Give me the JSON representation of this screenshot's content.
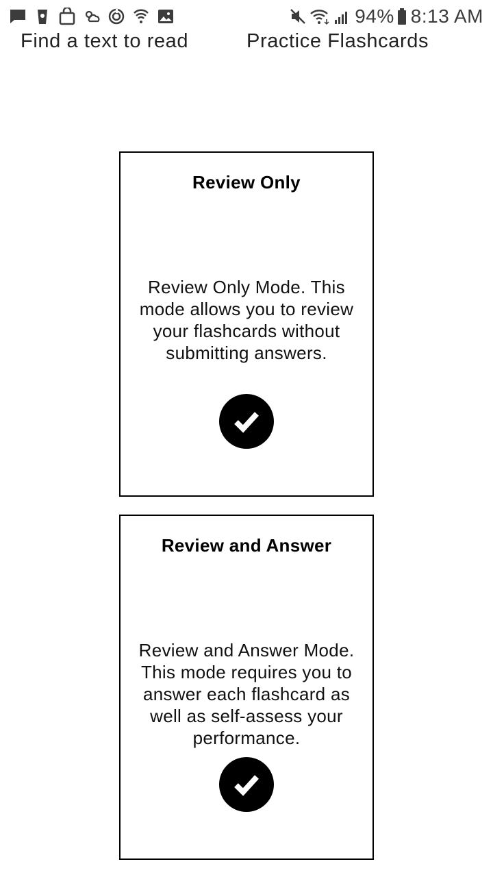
{
  "status_bar": {
    "notification_icons": [
      "message-icon",
      "cup-icon",
      "shopping-bag-icon",
      "weather-icon",
      "sync-icon",
      "wifi-call-icon",
      "image-icon"
    ],
    "system_icons": [
      "mute-icon",
      "wifi-icon",
      "signal-icon"
    ],
    "battery": "94%",
    "time": "8:13 AM"
  },
  "nav": {
    "find_text": "Find a text to read",
    "practice": "Practice Flashcards"
  },
  "cards": [
    {
      "title": "Review Only",
      "description": "Review Only Mode. This mode allows you to review your flashcards without submitting answers.",
      "icon": "check-circle-icon"
    },
    {
      "title": "Review and Answer",
      "description": "Review and Answer Mode. This mode requires you to answer each flashcard as well as self-assess your performance.",
      "icon": "check-circle-icon"
    }
  ],
  "colors": {
    "text": "#000000",
    "status_icons": "#3c3c3c",
    "background": "#ffffff"
  }
}
